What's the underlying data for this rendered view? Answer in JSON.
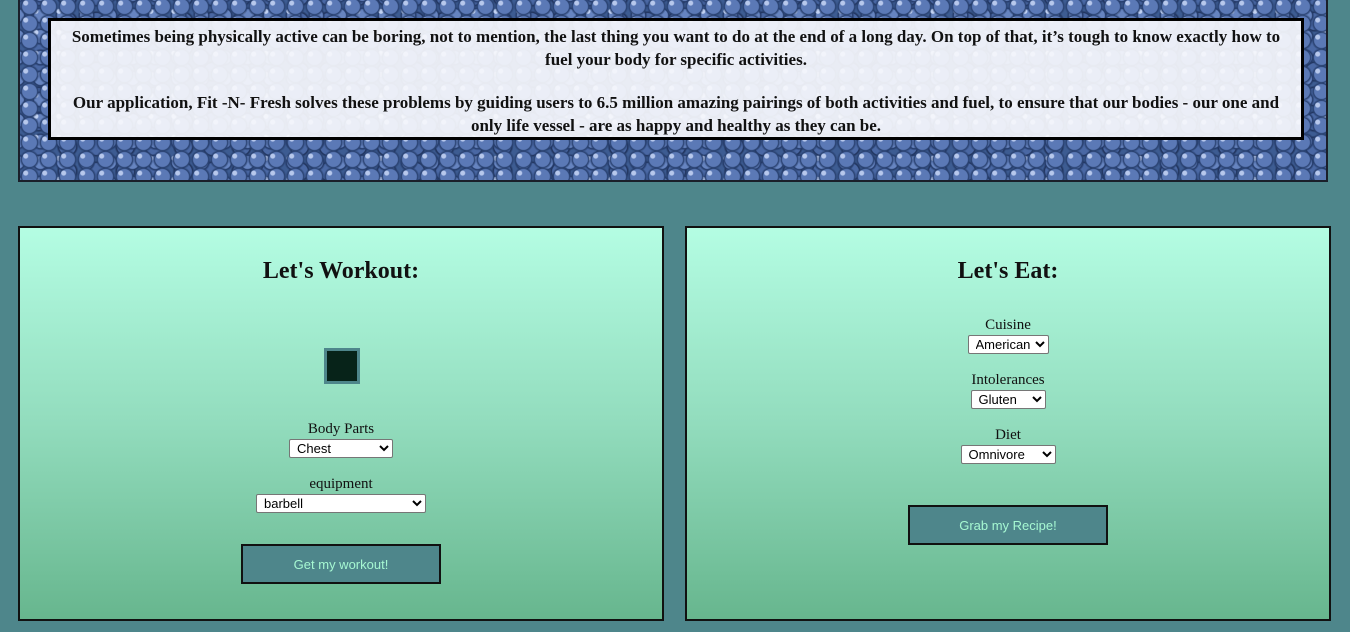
{
  "banner": {
    "paragraph_1": "Sometimes being physically active can be boring, not to mention, the last thing you want to do at the end of a long day. On top of that, it’s tough to know exactly how to fuel your body for specific activities.",
    "paragraph_2": "Our application, Fit -N- Fresh solves these problems by guiding users to 6.5 million amazing pairings of both activities and fuel, to ensure that our bodies - our one and only life vessel - are as happy and healthy as they can be."
  },
  "workout": {
    "title": "Let's Workout:",
    "body_parts_label": "Body Parts",
    "body_parts_value": "Chest",
    "equipment_label": "equipment",
    "equipment_value": "barbell",
    "button_label": "Get my workout!"
  },
  "eat": {
    "title": "Let's Eat:",
    "cuisine_label": "Cuisine",
    "cuisine_value": "American",
    "intolerances_label": "Intolerances",
    "intolerances_value": "Gluten",
    "diet_label": "Diet",
    "diet_value": "Omnivore",
    "button_label": "Grab my Recipe!"
  },
  "colors": {
    "page_background": "#4e868b",
    "button_background": "#4e868b",
    "button_text": "#a6f8d2",
    "panel_gradient_top": "#b4fde3",
    "panel_gradient_bottom": "#67b68e"
  }
}
